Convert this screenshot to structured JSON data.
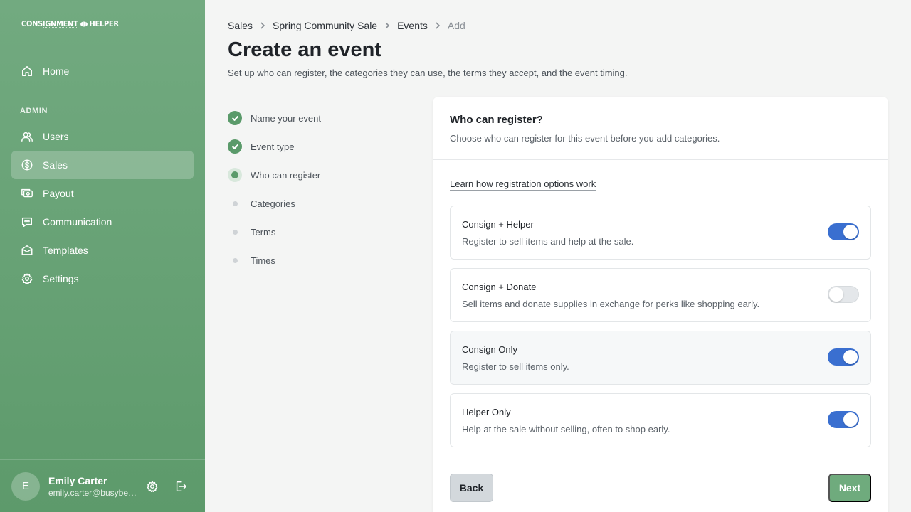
{
  "app": {
    "logo_left": "CONSIGNMENT",
    "logo_right": "HELPER"
  },
  "sidebar": {
    "section_admin": "ADMIN",
    "items": [
      {
        "label": "Home",
        "icon": "home-icon"
      },
      {
        "label": "Users",
        "icon": "users-icon"
      },
      {
        "label": "Sales",
        "icon": "dollar-icon",
        "active": true
      },
      {
        "label": "Payout",
        "icon": "payout-icon"
      },
      {
        "label": "Communication",
        "icon": "chat-icon"
      },
      {
        "label": "Templates",
        "icon": "envelope-icon"
      },
      {
        "label": "Settings",
        "icon": "gear-icon"
      }
    ],
    "user": {
      "initial": "E",
      "name": "Emily Carter",
      "email": "emily.carter@busybee...."
    }
  },
  "breadcrumb": [
    "Sales",
    "Spring Community Sale",
    "Events",
    "Add"
  ],
  "page": {
    "title": "Create an event",
    "subtitle": "Set up who can register, the categories they can use, the terms they accept, and the event timing."
  },
  "steps": [
    {
      "label": "Name your event",
      "state": "done"
    },
    {
      "label": "Event type",
      "state": "done"
    },
    {
      "label": "Who can register",
      "state": "current"
    },
    {
      "label": "Categories",
      "state": "todo"
    },
    {
      "label": "Terms",
      "state": "todo"
    },
    {
      "label": "Times",
      "state": "todo"
    }
  ],
  "card": {
    "title": "Who can register?",
    "subtitle": "Choose who can register for this event before you add categories.",
    "help_link": "Learn how registration options work",
    "options": [
      {
        "title": "Consign + Helper",
        "desc": "Register to sell items and help at the sale.",
        "enabled": true
      },
      {
        "title": "Consign + Donate",
        "desc": "Sell items and donate supplies in exchange for perks like shopping early.",
        "enabled": false
      },
      {
        "title": "Consign Only",
        "desc": "Register to sell items only.",
        "enabled": true
      },
      {
        "title": "Helper Only",
        "desc": "Help at the sale without selling, often to shop early.",
        "enabled": true
      }
    ],
    "back_label": "Back",
    "next_label": "Next"
  },
  "colors": {
    "sidebar_top": "#72aa80",
    "sidebar_bottom": "#5d9a6b",
    "toggle_on": "#3a6fd0",
    "primary_button": "#6fab7d",
    "step_done": "#5a9a6a"
  }
}
